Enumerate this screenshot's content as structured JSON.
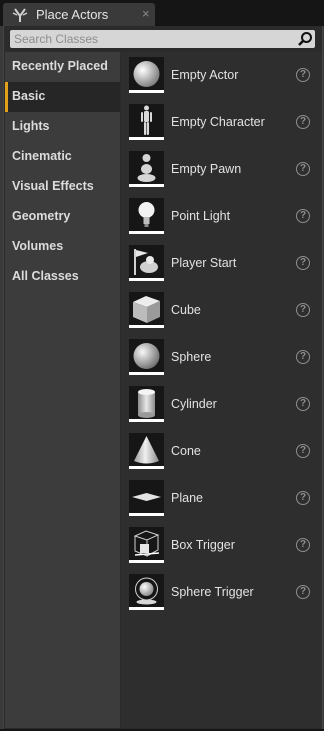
{
  "tab": {
    "title": "Place Actors",
    "close": "×"
  },
  "search": {
    "placeholder": "Search Classes"
  },
  "categories": [
    {
      "label": "Recently Placed",
      "active": false
    },
    {
      "label": "Basic",
      "active": true
    },
    {
      "label": "Lights",
      "active": false
    },
    {
      "label": "Cinematic",
      "active": false
    },
    {
      "label": "Visual Effects",
      "active": false
    },
    {
      "label": "Geometry",
      "active": false
    },
    {
      "label": "Volumes",
      "active": false
    },
    {
      "label": "All Classes",
      "active": false
    }
  ],
  "items": [
    {
      "label": "Empty Actor",
      "icon": "empty-actor-icon"
    },
    {
      "label": "Empty Character",
      "icon": "empty-character-icon"
    },
    {
      "label": "Empty Pawn",
      "icon": "empty-pawn-icon"
    },
    {
      "label": "Point Light",
      "icon": "point-light-icon"
    },
    {
      "label": "Player Start",
      "icon": "player-start-icon"
    },
    {
      "label": "Cube",
      "icon": "cube-icon"
    },
    {
      "label": "Sphere",
      "icon": "sphere-icon"
    },
    {
      "label": "Cylinder",
      "icon": "cylinder-icon"
    },
    {
      "label": "Cone",
      "icon": "cone-icon"
    },
    {
      "label": "Plane",
      "icon": "plane-icon"
    },
    {
      "label": "Box Trigger",
      "icon": "box-trigger-icon"
    },
    {
      "label": "Sphere Trigger",
      "icon": "sphere-trigger-icon"
    }
  ],
  "help_glyph": "?",
  "colors": {
    "accent": "#e0a21a",
    "search_bg": "#d6d6d6",
    "panel_bg": "#2b2b2b"
  }
}
